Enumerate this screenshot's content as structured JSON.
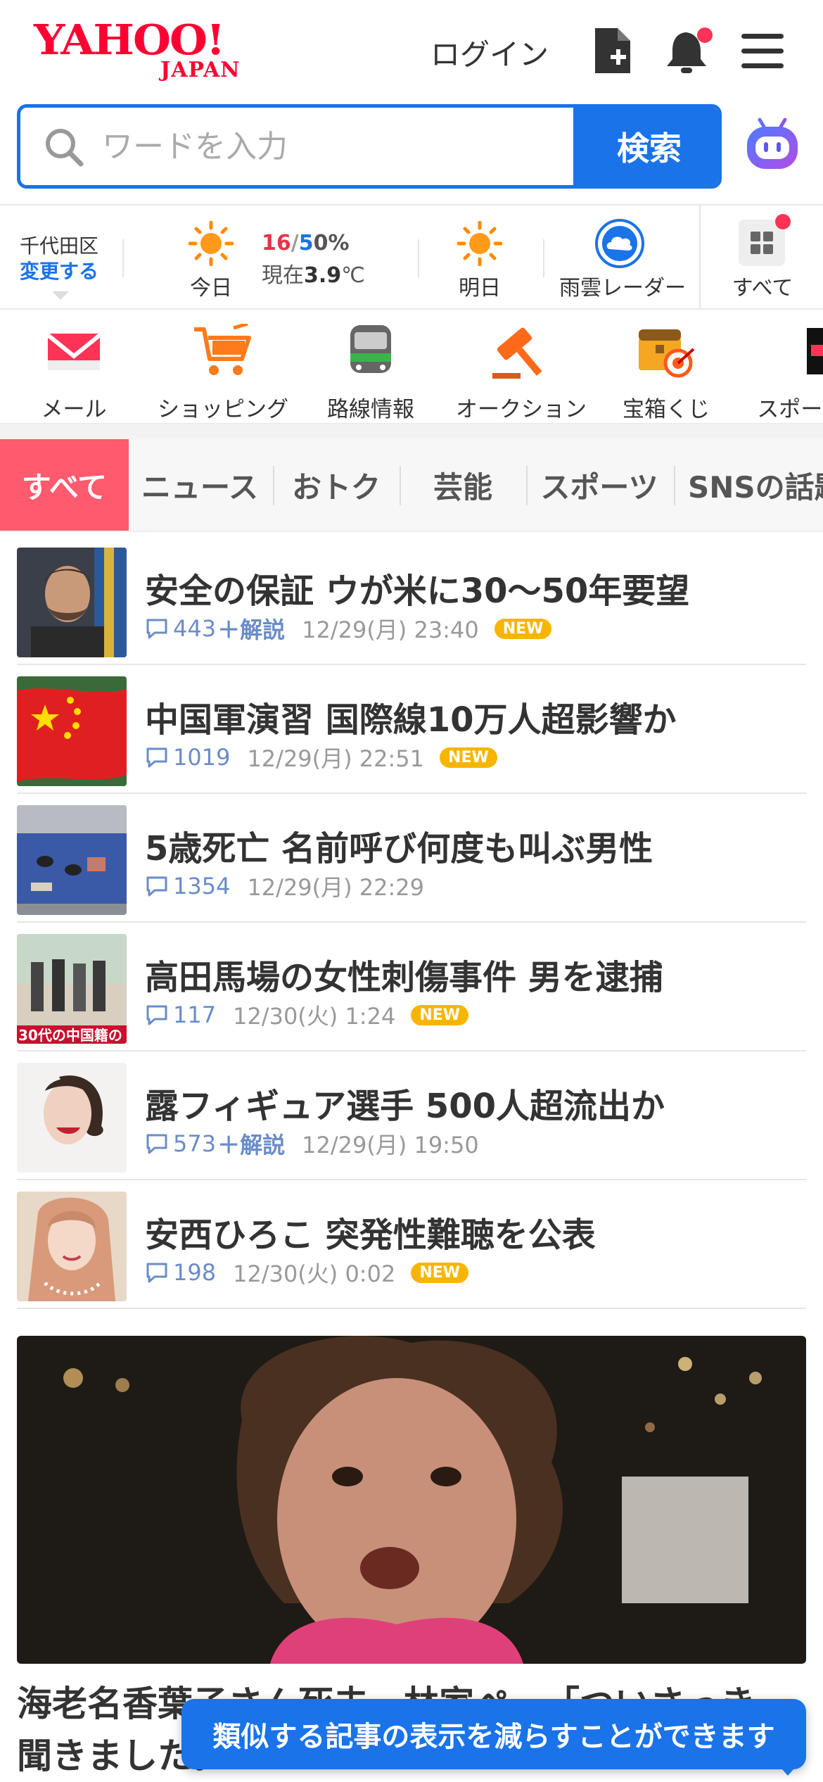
{
  "header": {
    "logo_main": "YAHOO!",
    "logo_sub": "JAPAN",
    "login_label": "ログイン"
  },
  "search": {
    "placeholder": "ワードを入力",
    "button_label": "検索"
  },
  "weather": {
    "location": "千代田区",
    "change_label": "変更する",
    "today_label": "今日",
    "high": "16",
    "separator": "/",
    "low": "5",
    "rain": "0%",
    "now_prefix": "現在",
    "now_temp": "3.9",
    "now_unit": "℃",
    "tomorrow_label": "明日",
    "radar_label": "雨雲レーダー",
    "all_label": "すべて"
  },
  "services": [
    {
      "label": "メール",
      "icon": "mail-icon"
    },
    {
      "label": "ショッピング",
      "icon": "cart-icon"
    },
    {
      "label": "路線情報",
      "icon": "train-icon"
    },
    {
      "label": "オークション",
      "icon": "gavel-icon"
    },
    {
      "label": "宝箱くじ",
      "icon": "treasure-icon"
    },
    {
      "label": "スポーツ",
      "icon": "sports-icon"
    }
  ],
  "tabs": [
    "すべて",
    "ニュース",
    "おトク",
    "芸能",
    "スポーツ",
    "SNSの話題"
  ],
  "news": [
    {
      "headline": "安全の保証 ウが米に30〜50年要望",
      "comments": "443",
      "comment_extra": "＋解説",
      "time": "12/29(月) 23:40",
      "badge": "NEW"
    },
    {
      "headline": "中国軍演習 国際線10万人超影響か",
      "comments": "1019",
      "comment_extra": "",
      "time": "12/29(月) 22:51",
      "badge": "NEW"
    },
    {
      "headline": "5歳死亡 名前呼び何度も叫ぶ男性",
      "comments": "1354",
      "comment_extra": "",
      "time": "12/29(月) 22:29",
      "badge": ""
    },
    {
      "headline": "高田馬場の女性刺傷事件 男を逮捕",
      "comments": "117",
      "comment_extra": "",
      "time": "12/30(火) 1:24",
      "badge": "NEW"
    },
    {
      "headline": "露フィギュア選手 500人超流出か",
      "comments": "573",
      "comment_extra": "＋解説",
      "time": "12/29(月) 19:50",
      "badge": ""
    },
    {
      "headline": "安西ひろこ 突発性難聴を公表",
      "comments": "198",
      "comment_extra": "",
      "time": "12/30(火) 0:02",
      "badge": "NEW"
    }
  ],
  "thumb4_caption": "30代の中国籍の",
  "feature": {
    "title": "海老名香葉子さん死去　林家ぺー「ついさっき、聞きました。"
  },
  "toast": "類似する記事の表示を減らすことができます",
  "colors": {
    "brand_red": "#ff0033",
    "accent_blue": "#1a73e8",
    "tab_active": "#ff5a6e",
    "new_badge": "#f7b500"
  }
}
